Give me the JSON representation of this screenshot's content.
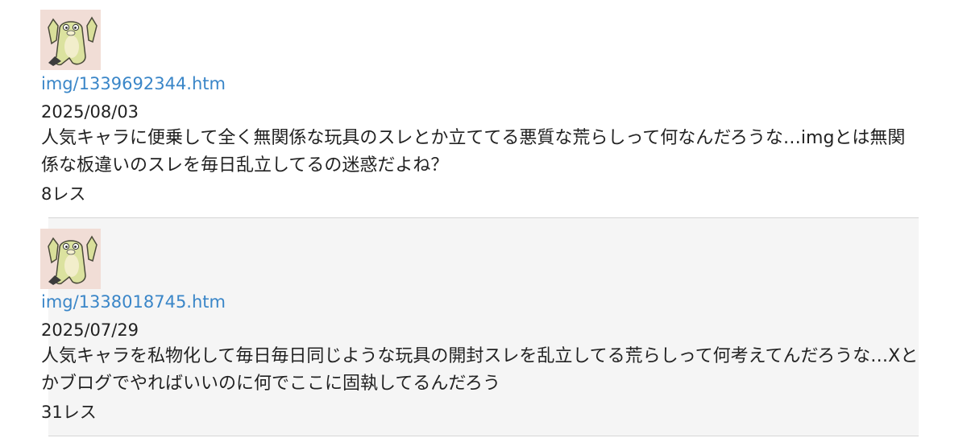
{
  "threads": [
    {
      "thumb_icon": "seal-mascot-icon",
      "link": "img/1339692344.htm",
      "date": "2025/08/03",
      "text": "人気キャラに便乗して全く無関係な玩具のスレとか立ててる悪質な荒らしって何なんだろうな…imgとは無関係な板違いのスレを毎日乱立してるの迷惑だよね？",
      "res": "8レス"
    },
    {
      "thumb_icon": "seal-mascot-icon",
      "link": "img/1338018745.htm",
      "date": "2025/07/29",
      "text": "人気キャラを私物化して毎日毎日同じような玩具の開封スレを乱立してる荒らしって何考えてんだろうな…Xとかブログでやればいいのに何でここに固執してるんだろう",
      "res": "31レス"
    }
  ],
  "colors": {
    "link": "#3a86c8",
    "thumb_bg": "#f1ddd6",
    "row_alt_bg": "#f5f5f5",
    "divider": "#d6d6d6"
  }
}
